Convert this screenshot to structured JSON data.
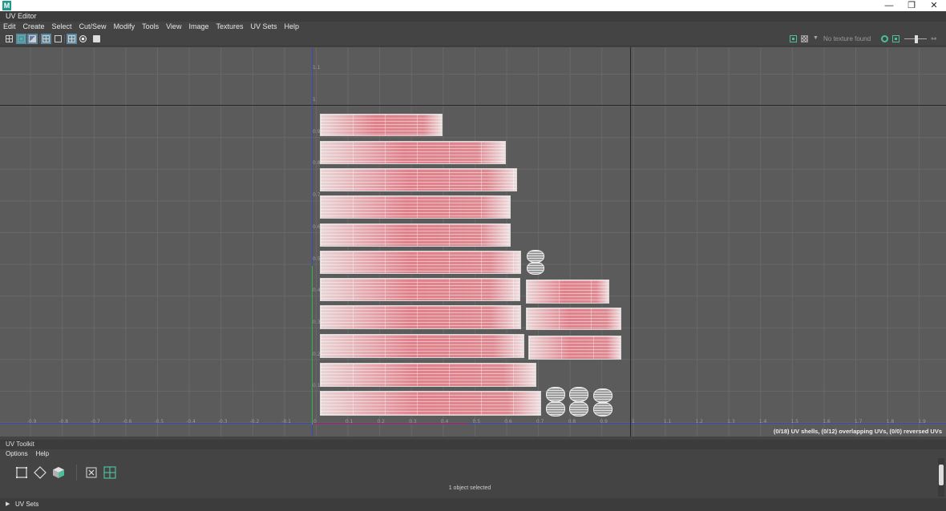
{
  "window": {
    "app_icon": "M",
    "minimize": "—",
    "restore": "❐",
    "close": "✕"
  },
  "panel": {
    "title": "UV Editor"
  },
  "menu": [
    "Edit",
    "Create",
    "Select",
    "Cut/Sew",
    "Modify",
    "Tools",
    "View",
    "Image",
    "Textures",
    "UV Sets",
    "Help"
  ],
  "toolbar": {
    "texture_status": "No texture found",
    "left_icons": [
      "grid-toggle-icon",
      "shaded-icon",
      "image-icon",
      "grid-icon",
      "uv-grid-icon",
      "snap-grid-icon",
      "checker-icon",
      "camera-icon"
    ],
    "right_icons": [
      "image-display-icon",
      "checker-display-icon",
      "refresh-icon",
      "texture-icon"
    ]
  },
  "viewport": {
    "axis_x_ticks": [
      "-0.9",
      "-0.8",
      "-0.7",
      "-0.6",
      "-0.5",
      "-0.4",
      "-0.3",
      "-0.2",
      "-0.1",
      "0",
      "0.1",
      "0.2",
      "0.3",
      "0.4",
      "0.5",
      "0.6",
      "0.7",
      "0.8",
      "0.9",
      "1",
      "1.1",
      "1.2",
      "1.3",
      "1.4",
      "1.5",
      "1.6",
      "1.7",
      "1.8",
      "1.9"
    ],
    "axis_y_ticks": [
      "1.1",
      "1",
      "0.9",
      "0.8",
      "0.7",
      "0.6",
      "0.5",
      "0.4",
      "0.3",
      "0.2",
      "0.1"
    ],
    "status": "(0/18) UV shells, (0/12) overlapping UVs, (0/0) reversed UVs"
  },
  "toolkit": {
    "title": "UV Toolkit",
    "menu": [
      "Options",
      "Help"
    ],
    "icons": [
      "uv-shell-select-icon",
      "uv-select-icon",
      "face-select-icon",
      "cut-icon",
      "layout-icon"
    ],
    "selection_status": "1 object selected"
  },
  "uv_sets": {
    "label": "UV Sets",
    "arrow": "▶"
  }
}
